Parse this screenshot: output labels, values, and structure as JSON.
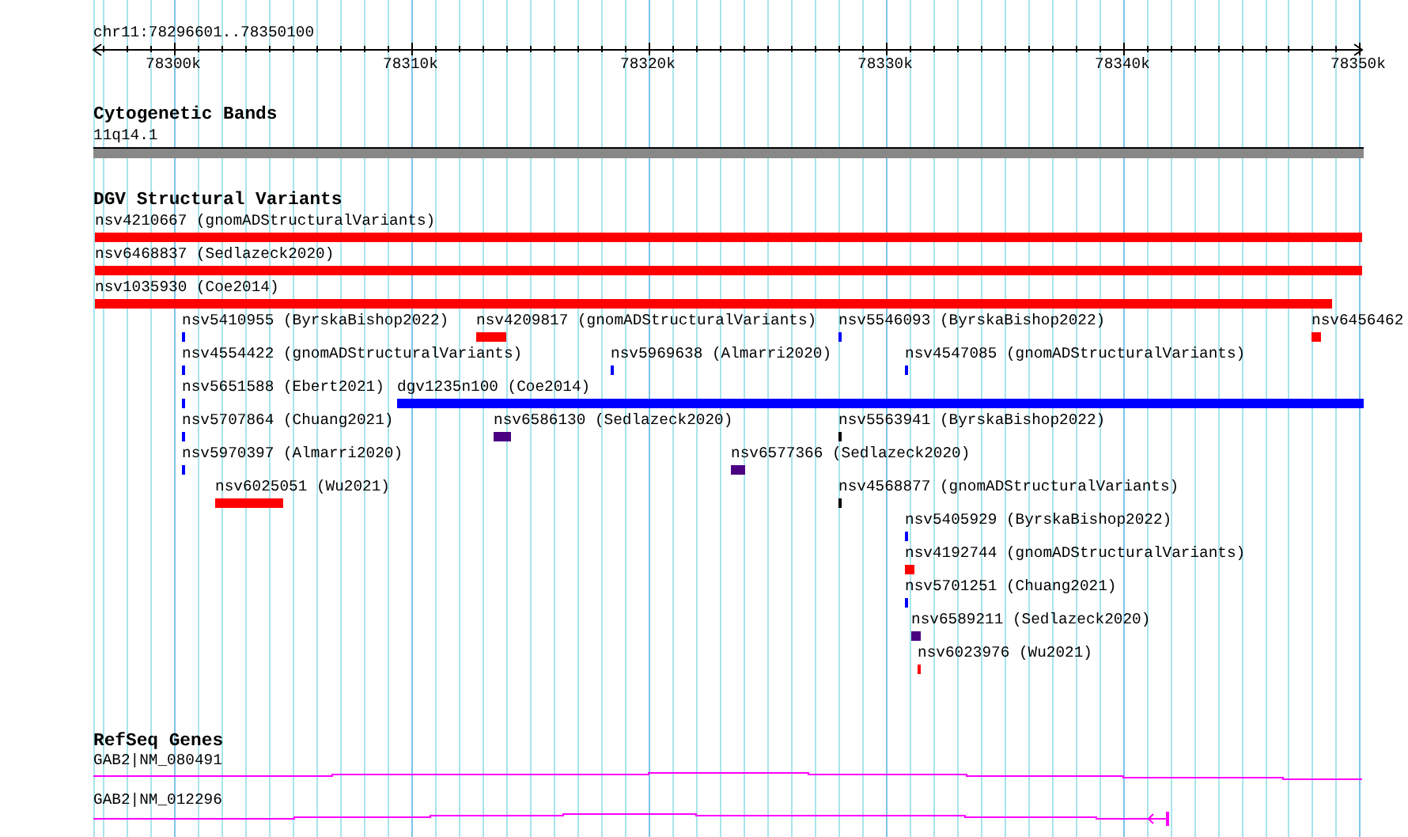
{
  "ruler": {
    "label": "chr11:78296601..78350100",
    "ticks": [
      "78300k",
      "78310k",
      "78320k",
      "78330k",
      "78340k",
      "78350k"
    ]
  },
  "tracks": [
    {
      "kind": "bands",
      "title": "Cytogenetic Bands",
      "features": [
        {
          "label": "11q14.1"
        }
      ]
    },
    {
      "kind": "variants",
      "title": "DGV Structural Variants",
      "features": [
        {
          "label": "nsv4210667 (gnomADStructuralVariants)",
          "color": "#ff0000"
        },
        {
          "label": "nsv6468837 (Sedlazeck2020)",
          "color": "#ff0000"
        },
        {
          "label": "nsv1035930 (Coe2014)",
          "color": "#ff0000"
        },
        {
          "label": "nsv5410955 (ByrskaBishop2022)",
          "color": "#0000ff"
        },
        {
          "label": "nsv4209817 (gnomADStructuralVariants)",
          "color": "#ff0000"
        },
        {
          "label": "nsv5546093 (ByrskaBishop2022)",
          "color": "#0000ff"
        },
        {
          "label": "nsv6456462",
          "color": "#ff0000"
        },
        {
          "label": "nsv4554422 (gnomADStructuralVariants)",
          "color": "#0000ff"
        },
        {
          "label": "nsv5969638 (Almarri2020)",
          "color": "#0000ff"
        },
        {
          "label": "nsv4547085 (gnomADStructuralVariants)",
          "color": "#0000ff"
        },
        {
          "label": "nsv5651588 (Ebert2021)",
          "color": "#0000ff"
        },
        {
          "label": "dgv1235n100 (Coe2014)",
          "color": "#0000ff"
        },
        {
          "label": "nsv5707864 (Chuang2021)",
          "color": "#0000ff"
        },
        {
          "label": "nsv6586130 (Sedlazeck2020)",
          "color": "#4b0082"
        },
        {
          "label": "nsv5563941 (ByrskaBishop2022)",
          "color": "#000000"
        },
        {
          "label": "nsv5970397 (Almarri2020)",
          "color": "#0000ff"
        },
        {
          "label": "nsv6577366 (Sedlazeck2020)",
          "color": "#4b0082"
        },
        {
          "label": "nsv6025051 (Wu2021)",
          "color": "#ff0000"
        },
        {
          "label": "nsv4568877 (gnomADStructuralVariants)",
          "color": "#000000"
        },
        {
          "label": "nsv5405929 (ByrskaBishop2022)",
          "color": "#0000ff"
        },
        {
          "label": "nsv4192744 (gnomADStructuralVariants)",
          "color": "#ff0000"
        },
        {
          "label": "nsv5701251 (Chuang2021)",
          "color": "#0000ff"
        },
        {
          "label": "nsv6589211 (Sedlazeck2020)",
          "color": "#4b0082"
        },
        {
          "label": "nsv6023976 (Wu2021)",
          "color": "#ff0000"
        }
      ]
    },
    {
      "kind": "genes",
      "title": "RefSeq Genes",
      "features": [
        {
          "label": "GAB2|NM_080491"
        },
        {
          "label": "GAB2|NM_012296"
        }
      ]
    }
  ]
}
